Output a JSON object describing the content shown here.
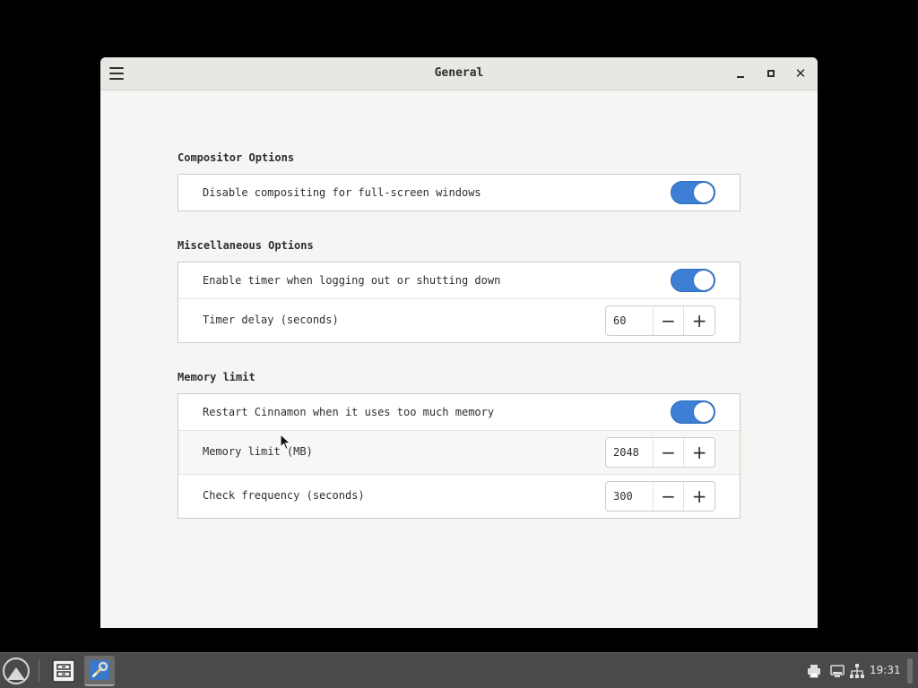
{
  "window": {
    "title": "General"
  },
  "sections": {
    "compositor": {
      "title": "Compositor Options",
      "disable_compositing": {
        "label": "Disable compositing for full-screen windows",
        "enabled": true
      }
    },
    "misc": {
      "title": "Miscellaneous Options",
      "enable_timer": {
        "label": "Enable timer when logging out or shutting down",
        "enabled": true
      },
      "timer_delay": {
        "label": "Timer delay (seconds)",
        "value": "60"
      }
    },
    "memory": {
      "title": "Memory limit",
      "restart_cinnamon": {
        "label": "Restart Cinnamon when it uses too much memory",
        "enabled": true
      },
      "memory_limit": {
        "label": "Memory limit (MB)",
        "value": "2048"
      },
      "check_frequency": {
        "label": "Check frequency (seconds)",
        "value": "300"
      }
    }
  },
  "spin_buttons": {
    "minus": "−",
    "plus": "+"
  },
  "window_controls": {
    "close": "✕"
  },
  "taskbar": {
    "clock": "19:31",
    "apps": [
      "files-icon",
      "settings-icon"
    ],
    "tray": [
      "printer-icon",
      "display-icon",
      "network-icon"
    ]
  },
  "colors": {
    "accent": "#3d7fd4",
    "window_bg": "#f6f5f3",
    "taskbar_bg": "#4a4a4a"
  }
}
